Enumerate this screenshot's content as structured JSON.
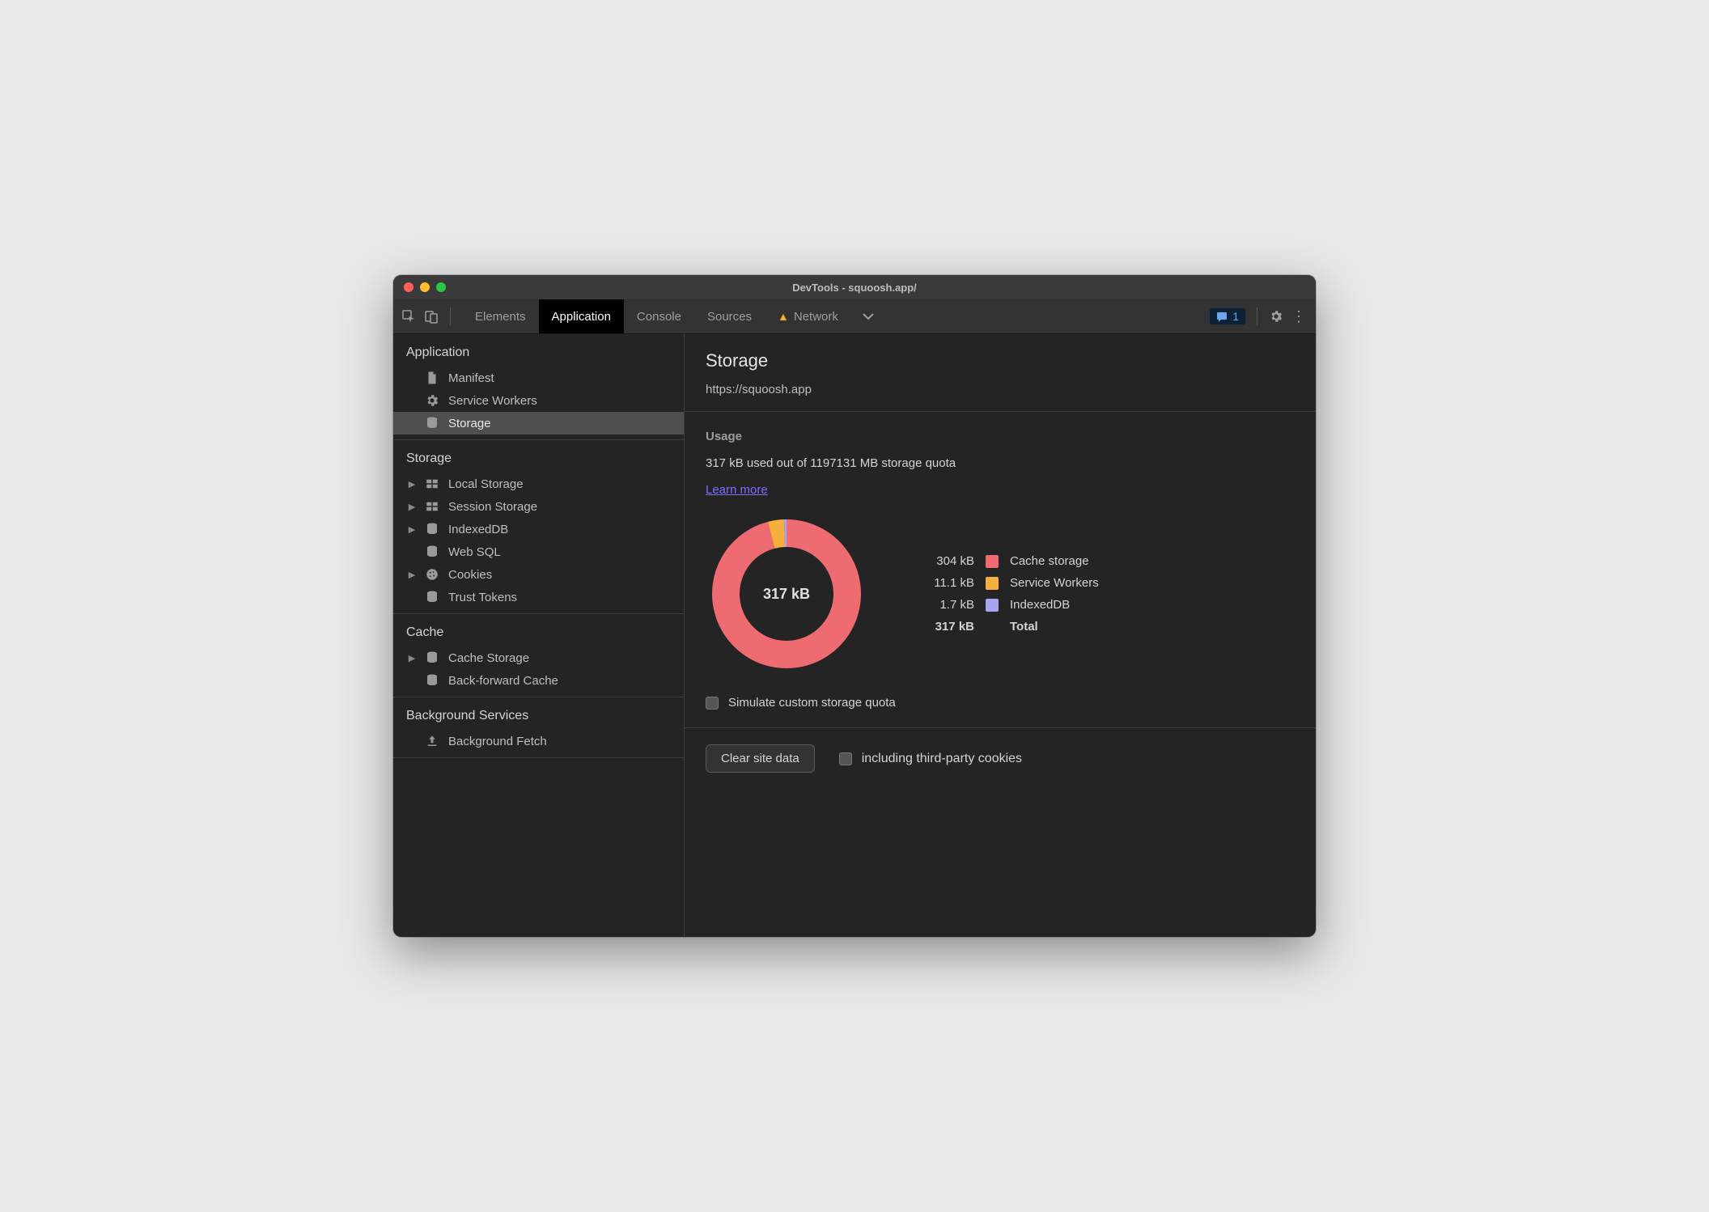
{
  "window": {
    "title": "DevTools - squoosh.app/"
  },
  "toolbar": {
    "tabs": [
      {
        "label": "Elements"
      },
      {
        "label": "Application"
      },
      {
        "label": "Console"
      },
      {
        "label": "Sources"
      },
      {
        "label": "Network",
        "warning": true
      }
    ],
    "issue_count": "1"
  },
  "sidebar": {
    "groups": [
      {
        "title": "Application",
        "items": [
          {
            "label": "Manifest",
            "icon": "file"
          },
          {
            "label": "Service Workers",
            "icon": "gear"
          },
          {
            "label": "Storage",
            "icon": "db",
            "selected": true
          }
        ]
      },
      {
        "title": "Storage",
        "items": [
          {
            "label": "Local Storage",
            "icon": "grid",
            "expandable": true
          },
          {
            "label": "Session Storage",
            "icon": "grid",
            "expandable": true
          },
          {
            "label": "IndexedDB",
            "icon": "db",
            "expandable": true
          },
          {
            "label": "Web SQL",
            "icon": "db"
          },
          {
            "label": "Cookies",
            "icon": "cookie",
            "expandable": true
          },
          {
            "label": "Trust Tokens",
            "icon": "db"
          }
        ]
      },
      {
        "title": "Cache",
        "items": [
          {
            "label": "Cache Storage",
            "icon": "db",
            "expandable": true
          },
          {
            "label": "Back-forward Cache",
            "icon": "db"
          }
        ]
      },
      {
        "title": "Background Services",
        "items": [
          {
            "label": "Background Fetch",
            "icon": "upload"
          }
        ]
      }
    ]
  },
  "panel": {
    "title": "Storage",
    "url": "https://squoosh.app",
    "usage": {
      "heading": "Usage",
      "summary": "317 kB used out of 1197131 MB storage quota",
      "learn_more": "Learn more",
      "total_label": "317 kB",
      "simulate_label": "Simulate custom storage quota",
      "legend": [
        {
          "size": "304 kB",
          "label": "Cache storage",
          "color": "#ee6b72"
        },
        {
          "size": "11.1 kB",
          "label": "Service Workers",
          "color": "#f6ae3c"
        },
        {
          "size": "1.7 kB",
          "label": "IndexedDB",
          "color": "#a9a4ef"
        },
        {
          "size": "317 kB",
          "label": "Total",
          "total": true
        }
      ]
    },
    "clear_label": "Clear site data",
    "third_party_label": "including third-party cookies"
  },
  "chart_data": {
    "type": "pie",
    "title": "Storage usage breakdown",
    "total": {
      "value": 317,
      "unit": "kB"
    },
    "series": [
      {
        "name": "Cache storage",
        "value": 304,
        "unit": "kB",
        "color": "#ee6b72"
      },
      {
        "name": "Service Workers",
        "value": 11.1,
        "unit": "kB",
        "color": "#f6ae3c"
      },
      {
        "name": "IndexedDB",
        "value": 1.7,
        "unit": "kB",
        "color": "#a9a4ef"
      }
    ],
    "quota": {
      "value": 1197131,
      "unit": "MB"
    }
  }
}
